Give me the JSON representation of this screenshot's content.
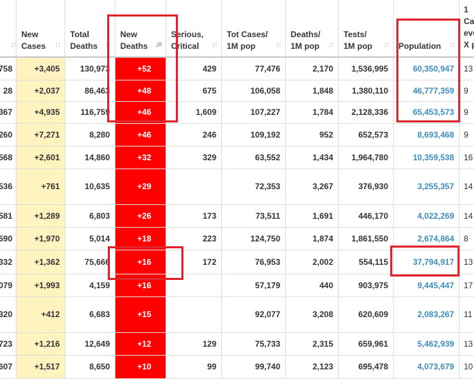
{
  "headers": [
    {
      "key": "country",
      "lines": [
        "",
        ""
      ]
    },
    {
      "key": "new_cases",
      "lines": [
        "New",
        "Cases"
      ]
    },
    {
      "key": "total_deaths",
      "lines": [
        "Total",
        "Deaths"
      ]
    },
    {
      "key": "new_deaths",
      "lines": [
        "New",
        "Deaths"
      ]
    },
    {
      "key": "serious_critical",
      "lines": [
        "Serious,",
        "Critical"
      ]
    },
    {
      "key": "tot_cases_1m",
      "lines": [
        "Tot Cases/",
        "1M pop"
      ]
    },
    {
      "key": "deaths_1m",
      "lines": [
        "Deaths/",
        "1M pop"
      ]
    },
    {
      "key": "tests_1m",
      "lines": [
        "Tests/",
        "1M pop"
      ]
    },
    {
      "key": "population",
      "lines": [
        "",
        "Population"
      ]
    },
    {
      "key": "cases_every_x",
      "lines": [
        "1",
        "Ca",
        "eve",
        "X p"
      ]
    }
  ],
  "rows": [
    {
      "c0": "758",
      "new_cases": "+3,405",
      "total_deaths": "130,973",
      "new_deaths": "+52",
      "serious": "429",
      "tot_cases_1m": "77,476",
      "deaths_1m": "2,170",
      "tests_1m": "1,536,995",
      "population": "60,350,947",
      "last": "13"
    },
    {
      "c0": "28",
      "new_cases": "+2,037",
      "total_deaths": "86,463",
      "new_deaths": "+48",
      "serious": "675",
      "tot_cases_1m": "106,058",
      "deaths_1m": "1,848",
      "tests_1m": "1,380,110",
      "population": "46,777,359",
      "last": "9"
    },
    {
      "c0": "367",
      "new_cases": "+4,935",
      "total_deaths": "116,759",
      "new_deaths": "+46",
      "serious": "1,609",
      "tot_cases_1m": "107,227",
      "deaths_1m": "1,784",
      "tests_1m": "2,128,336",
      "population": "65,453,573",
      "last": "9"
    },
    {
      "c0": "260",
      "new_cases": "+7,271",
      "total_deaths": "8,280",
      "new_deaths": "+46",
      "serious": "246",
      "tot_cases_1m": "109,192",
      "deaths_1m": "952",
      "tests_1m": "652,573",
      "population": "8,693,468",
      "last": "9"
    },
    {
      "c0": "568",
      "new_cases": "+2,601",
      "total_deaths": "14,860",
      "new_deaths": "+32",
      "serious": "329",
      "tot_cases_1m": "63,552",
      "deaths_1m": "1,434",
      "tests_1m": "1,964,780",
      "population": "10,359,538",
      "last": "16"
    },
    {
      "c0": "536",
      "new_cases": "+761",
      "total_deaths": "10,635",
      "new_deaths": "+29",
      "serious": "",
      "tot_cases_1m": "72,353",
      "deaths_1m": "3,267",
      "tests_1m": "376,930",
      "population": "3,255,357",
      "last": "14"
    },
    {
      "c0": "581",
      "new_cases": "+1,289",
      "total_deaths": "6,803",
      "new_deaths": "+26",
      "serious": "173",
      "tot_cases_1m": "73,511",
      "deaths_1m": "1,691",
      "tests_1m": "446,170",
      "population": "4,022,269",
      "last": "14"
    },
    {
      "c0": "590",
      "new_cases": "+1,970",
      "total_deaths": "5,014",
      "new_deaths": "+18",
      "serious": "223",
      "tot_cases_1m": "124,750",
      "deaths_1m": "1,874",
      "tests_1m": "1,861,550",
      "population": "2,674,864",
      "last": "8"
    },
    {
      "c0": "332",
      "new_cases": "+1,362",
      "total_deaths": "75,666",
      "new_deaths": "+16",
      "serious": "172",
      "tot_cases_1m": "76,953",
      "deaths_1m": "2,002",
      "tests_1m": "554,115",
      "population": "37,794,917",
      "last": "13"
    },
    {
      "c0": "079",
      "new_cases": "+1,993",
      "total_deaths": "4,159",
      "new_deaths": "+16",
      "serious": "",
      "tot_cases_1m": "57,179",
      "deaths_1m": "440",
      "tests_1m": "903,975",
      "population": "9,445,447",
      "last": "17"
    },
    {
      "c0": "320",
      "new_cases": "+412",
      "total_deaths": "6,683",
      "new_deaths": "+15",
      "serious": "",
      "tot_cases_1m": "92,077",
      "deaths_1m": "3,208",
      "tests_1m": "620,609",
      "population": "2,083,267",
      "last": "11"
    },
    {
      "c0": "723",
      "new_cases": "+1,216",
      "total_deaths": "12,649",
      "new_deaths": "+12",
      "serious": "129",
      "tot_cases_1m": "75,733",
      "deaths_1m": "2,315",
      "tests_1m": "659,961",
      "population": "5,462,939",
      "last": "13"
    },
    {
      "c0": "607",
      "new_cases": "+1,517",
      "total_deaths": "8,650",
      "new_deaths": "+10",
      "serious": "99",
      "tot_cases_1m": "99,740",
      "deaths_1m": "2,123",
      "tests_1m": "695,478",
      "population": "4,073,679",
      "last": "10"
    }
  ],
  "colors": {
    "new_cases_bg": "#fff3bf",
    "new_deaths_bg": "#ff0000",
    "population_text": "#3c8dbc",
    "annotation_border": "#e1242b"
  },
  "icons": {
    "sort_inactive": "sort-arrows-icon",
    "sort_active": "sort-descending-icon"
  }
}
